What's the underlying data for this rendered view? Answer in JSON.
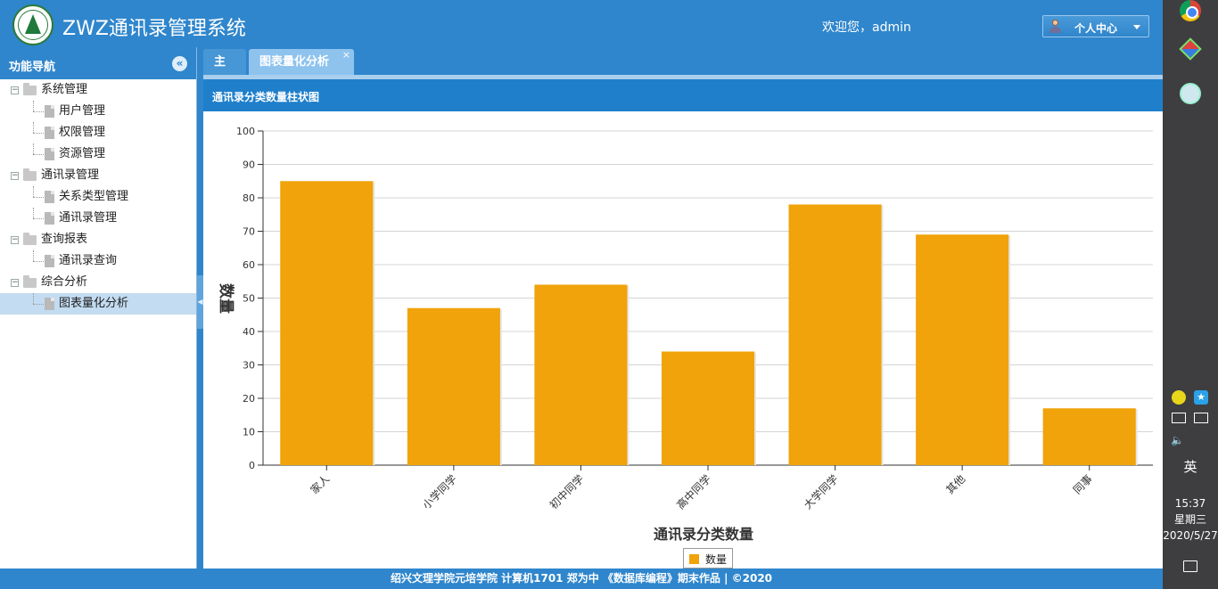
{
  "header": {
    "app_title": "ZWZ通讯录管理系统",
    "welcome": "欢迎您，admin",
    "user_menu_label": "个人中心"
  },
  "sidebar": {
    "title": "功能导航",
    "nodes": [
      {
        "label": "系统管理",
        "type": "folder",
        "level": 0
      },
      {
        "label": "用户管理",
        "type": "file",
        "level": 1
      },
      {
        "label": "权限管理",
        "type": "file",
        "level": 1
      },
      {
        "label": "资源管理",
        "type": "file",
        "level": 1
      },
      {
        "label": "通讯录管理",
        "type": "folder",
        "level": 0
      },
      {
        "label": "关系类型管理",
        "type": "file",
        "level": 1
      },
      {
        "label": "通讯录管理",
        "type": "file",
        "level": 1
      },
      {
        "label": "查询报表",
        "type": "folder",
        "level": 0
      },
      {
        "label": "通讯录查询",
        "type": "file",
        "level": 1
      },
      {
        "label": "综合分析",
        "type": "folder",
        "level": 0
      },
      {
        "label": "图表量化分析",
        "type": "file",
        "level": 1,
        "selected": true
      }
    ]
  },
  "tabs": [
    {
      "label": "主页"
    },
    {
      "label": "图表量化分析",
      "close": "×"
    }
  ],
  "panel": {
    "title": "通讯录分类数量柱状图"
  },
  "chart_data": {
    "type": "bar",
    "categories": [
      "家人",
      "小学同学",
      "初中同学",
      "高中同学",
      "大学同学",
      "其他",
      "同事"
    ],
    "series": [
      {
        "name": "数量",
        "values": [
          85,
          47,
          54,
          34,
          78,
          69,
          17
        ],
        "color": "#f0a30a"
      }
    ],
    "title": "",
    "xlabel": "通讯录分类数量",
    "ylabel": "数量",
    "ylim": [
      0,
      100
    ],
    "yticks": [
      0,
      10,
      20,
      30,
      40,
      50,
      60,
      70,
      80,
      90,
      100
    ],
    "grid": true,
    "legend": "bottom-center"
  },
  "footer": {
    "text": "绍兴文理学院元培学院 计算机1701 郑为中 《数据库编程》期末作品 | ©2020"
  },
  "taskbar": {
    "ime": "英",
    "time": "15:37",
    "weekday": "星期三",
    "date": "2020/5/27"
  }
}
